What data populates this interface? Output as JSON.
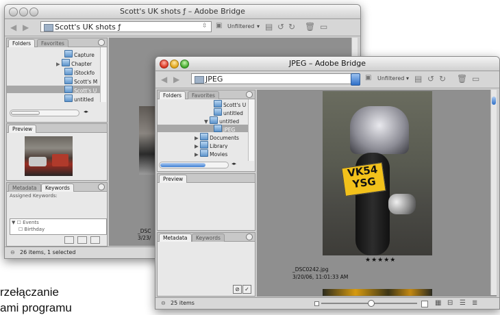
{
  "back_window": {
    "title": "Scott's UK shots ƒ – Adobe Bridge",
    "path": "Scott's UK shots ƒ",
    "filter_label": "Unfiltered",
    "panel_tabs": [
      "Folders",
      "Favorites"
    ],
    "folders": [
      "Capture",
      "Chapter",
      "iStockfo",
      "Scott's M",
      "Scott's U",
      "untitled"
    ],
    "selected_folder_index": 4,
    "preview_tab": "Preview",
    "meta_tabs": [
      "Metadata",
      "Keywords"
    ],
    "assigned_keywords_label": "Assigned Keywords:",
    "keywords": [
      "Events",
      "Birthday"
    ],
    "thumb_caption": [
      "_DSC",
      "3/23/"
    ],
    "status_text": "26 items, 1 selected"
  },
  "front_window": {
    "title": "JPEG – Adobe Bridge",
    "path": "JPEG",
    "filter_label": "Unfiltered",
    "panel_tabs": [
      "Folders",
      "Favorites"
    ],
    "folders": [
      {
        "label": "Scott's U",
        "indent": 3,
        "expand": ""
      },
      {
        "label": "untitled",
        "indent": 3,
        "expand": ""
      },
      {
        "label": "untitled",
        "indent": 2,
        "expand": "▼"
      },
      {
        "label": "JPEG",
        "indent": 3,
        "expand": ""
      },
      {
        "label": "Documents",
        "indent": 1,
        "expand": "▶"
      },
      {
        "label": "Library",
        "indent": 1,
        "expand": "▶"
      },
      {
        "label": "Movies",
        "indent": 1,
        "expand": "▶"
      }
    ],
    "selected_folder_index": 3,
    "preview_tab": "Preview",
    "meta_tabs": [
      "Metadata",
      "Keywords"
    ],
    "file_name": "_DSC0242.jpg",
    "file_date": "3/20/06, 11:01:33 AM",
    "rating": "★★★★★",
    "plate_line1": "VK54",
    "plate_line2": "YSG",
    "status_text": "25 items"
  },
  "background_text": [
    "rzełączanie",
    "ami programu"
  ],
  "colors": {
    "selection_gray": "#a7a7a7",
    "content_gray": "#8f8f8f",
    "path_button_blue": "#3d7fd4"
  }
}
